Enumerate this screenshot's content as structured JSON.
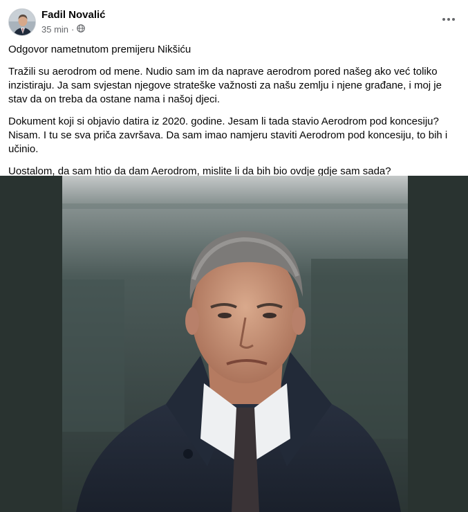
{
  "author": {
    "name": "Fadil Novalić"
  },
  "meta": {
    "time": "35 min",
    "separator": "·",
    "audience_icon": "globe-icon"
  },
  "more_icon": "more-dots-icon",
  "post": {
    "paragraphs": [
      "Odgovor nametnutom premijeru Nikšiću",
      "Tražili su aerodrom od mene. Nudio sam im da naprave aerodrom pored našeg ako već toliko inzistiraju. Ja sam svjestan njegove strateške važnosti za našu zemlju i njene građane, i moj je stav da on treba da ostane nama i našoj djeci.",
      "Dokument koji si objavio datira iz 2020. godine. Jesam li tada stavio Aerodrom pod koncesiju? Nisam. I tu se sva priča završava. Da sam imao namjeru staviti Aerodrom pod koncesiju, to bih i učinio.",
      "Uostalom, da sam htio da dam Aerodrom, mislite li da bih bio ovdje gdje sam sada?"
    ]
  },
  "colors": {
    "photo_bg": "#293330",
    "meta_text": "#65676b"
  }
}
